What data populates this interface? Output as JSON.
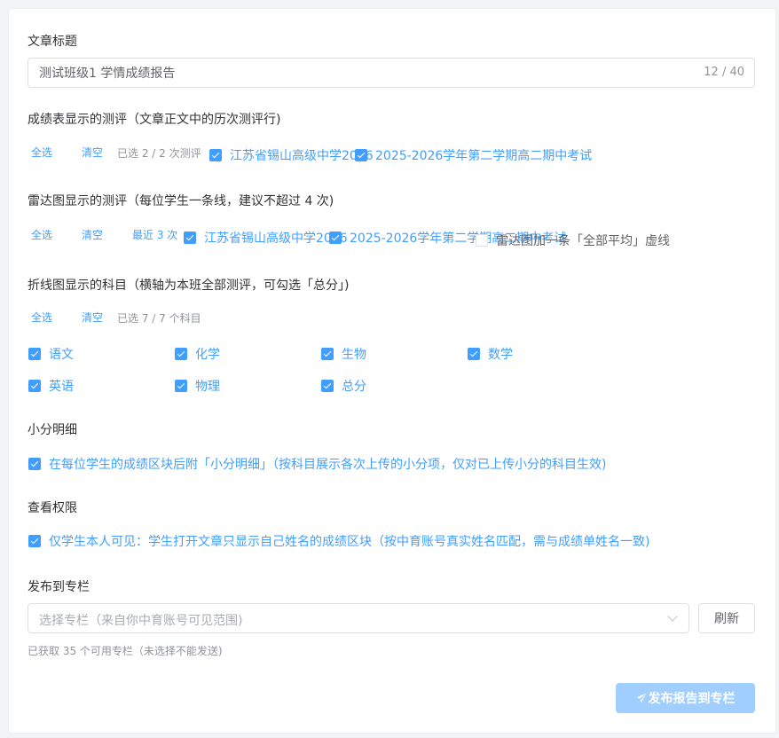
{
  "article": {
    "title_label": "文章标题",
    "title_value": "测试班级1 学情成绩报告",
    "title_counter": "12 / 40"
  },
  "score_table": {
    "label": "成绩表显示的测评（文章正文中的历次测评行)",
    "select_all": "全选",
    "clear": "清空",
    "selected_hint": "已选 2 / 2 次测评",
    "options": [
      {
        "label": "江苏省锡山高级中学2026",
        "checked": true
      },
      {
        "label": "2025-2026学年第二学期高二期中考试",
        "checked": true
      }
    ]
  },
  "radar": {
    "label": "雷达图显示的测评（每位学生一条线，建议不超过 4 次)",
    "select_all": "全选",
    "clear": "清空",
    "recent": "最近 3 次",
    "options": [
      {
        "label": "江苏省锡山高级中学2026",
        "checked": true
      },
      {
        "label": "2025-2026学年第二学期高二期中考试",
        "checked": true
      }
    ],
    "avg_line_option": {
      "label": "雷达图加一条「全部平均」虚线",
      "checked": false
    }
  },
  "line_chart": {
    "label": "折线图显示的科目（横轴为本班全部测评，可勾选「总分」)",
    "select_all": "全选",
    "clear": "清空",
    "selected_hint": "已选 7 / 7 个科目",
    "subjects": [
      {
        "label": "语文",
        "checked": true
      },
      {
        "label": "化学",
        "checked": true
      },
      {
        "label": "生物",
        "checked": true
      },
      {
        "label": "数学",
        "checked": true
      },
      {
        "label": "英语",
        "checked": true
      },
      {
        "label": "物理",
        "checked": true
      },
      {
        "label": "总分",
        "checked": true
      }
    ]
  },
  "detail": {
    "label": "小分明细",
    "option": {
      "label": "在每位学生的成绩区块后附「小分明细」（按科目展示各次上传的小分项，仅对已上传小分的科目生效)",
      "checked": true
    }
  },
  "permission": {
    "label": "查看权限",
    "option": {
      "label": "仅学生本人可见：学生打开文章只显示自己姓名的成绩区块（按中育账号真实姓名匹配，需与成绩单姓名一致)",
      "checked": true
    }
  },
  "publish": {
    "label": "发布到专栏",
    "select_placeholder": "选择专栏（来自你中育账号可见范围)",
    "refresh_label": "刷新",
    "fetched_hint": "已获取 35 个可用专栏（未选择不能发送)",
    "publish_label": "发布报告到专栏"
  },
  "colors": {
    "primary": "#409eff",
    "primary_disabled": "#a0cfff",
    "text": "#303133",
    "muted": "#909399"
  }
}
